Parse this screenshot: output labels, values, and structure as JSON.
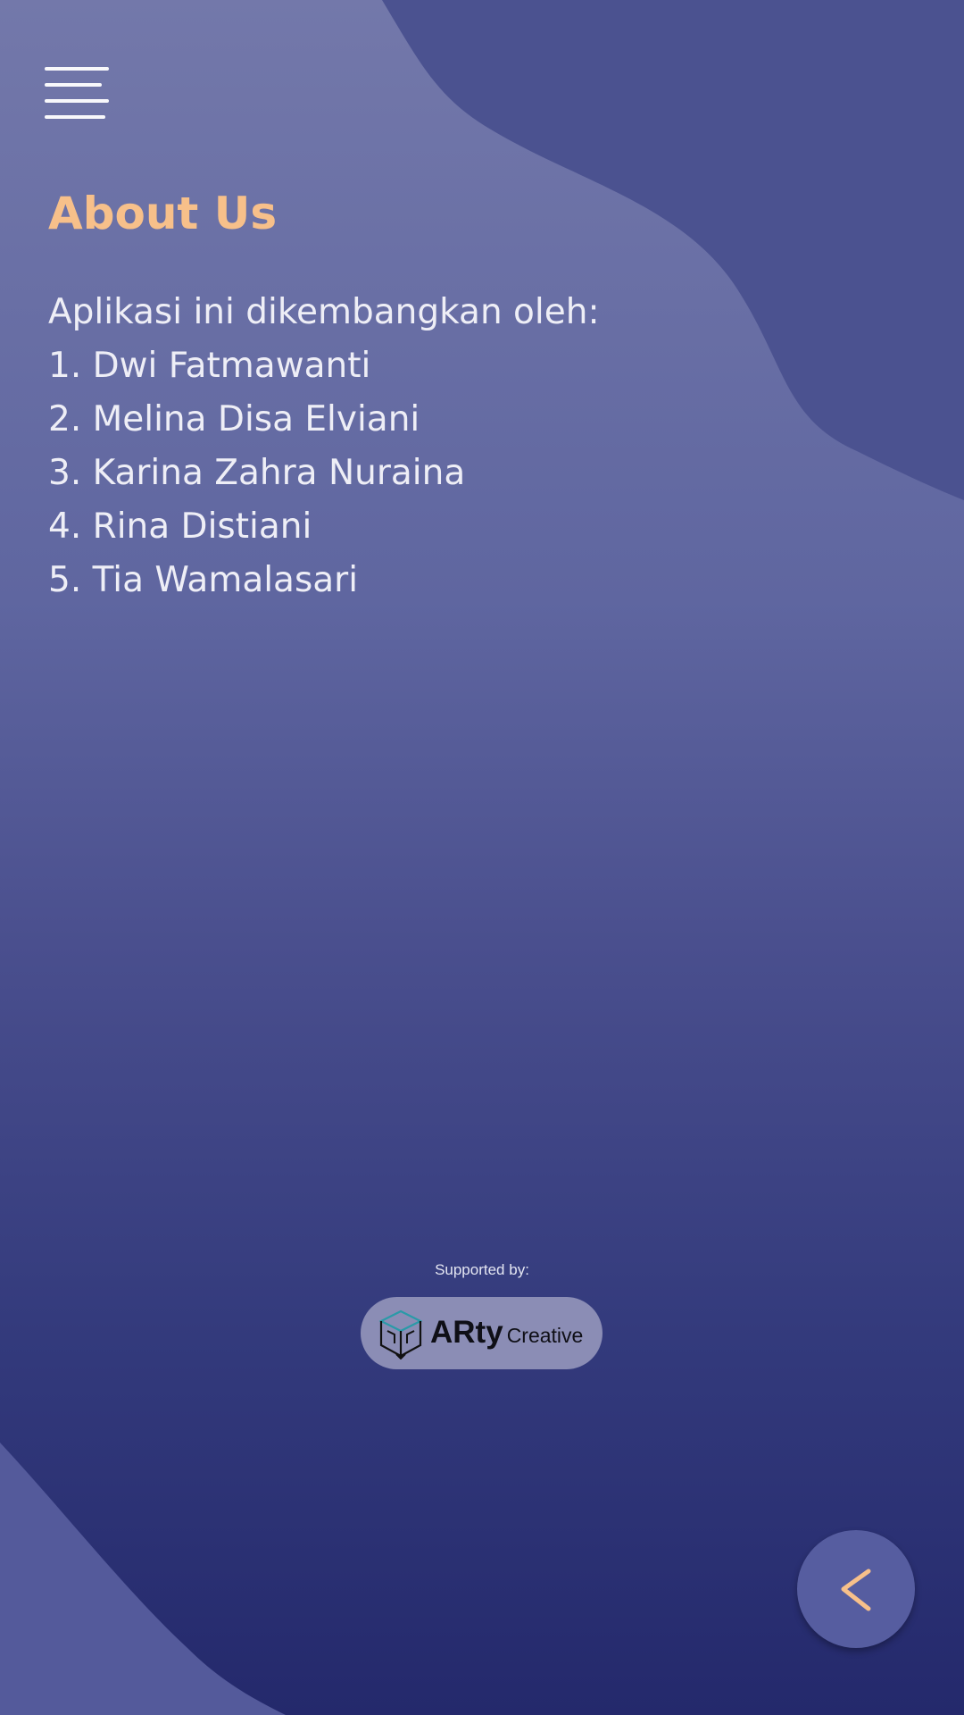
{
  "header": {
    "title": "About Us"
  },
  "about": {
    "intro": "Aplikasi ini dikembangkan oleh:",
    "developers": [
      "1. Dwi Fatmawanti",
      "2. Melina Disa Elviani",
      "3. Karina Zahra Nuraina",
      "4. Rina Distiani",
      "5. Tia Wamalasari"
    ]
  },
  "footer": {
    "supported_label": "Supported by:",
    "sponsor_name_main": "ARty",
    "sponsor_name_sub": "Creative"
  },
  "icons": {
    "menu": "hamburger-menu-icon",
    "back": "chevron-left-icon",
    "sponsor": "cube-logo-icon"
  },
  "colors": {
    "accent": "#f7c08a",
    "text": "#eeeef6",
    "background_top": "#7378aa",
    "background_bottom": "#24296c"
  }
}
